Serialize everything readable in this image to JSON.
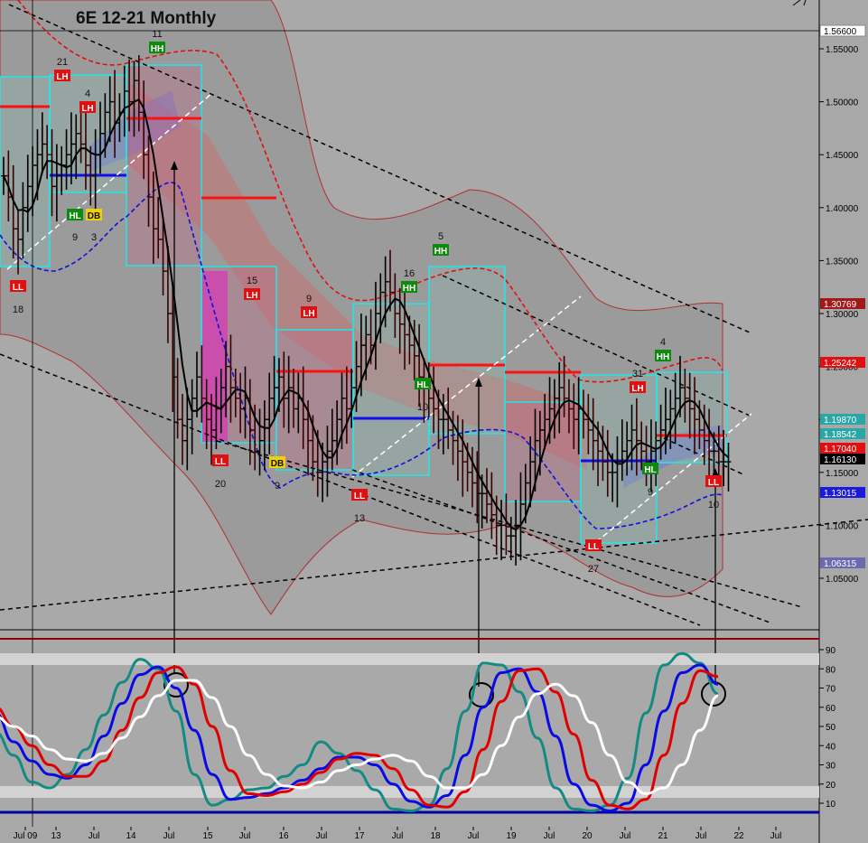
{
  "title": "6E 12-21 Monthly",
  "colors": {
    "background": "#a8a8a8",
    "price_bar": "#000000",
    "ma": "#000000",
    "upper_band": "#e01010",
    "lower_band": "#1010e0",
    "box": "#20e8e8",
    "label_red": "#e01010",
    "label_green": "#0e8a0e",
    "label_yellow": "#f0d000",
    "stoch_fast": "#138a82",
    "stoch_blue": "#0a0ae6",
    "stoch_red": "#e00000",
    "stoch_white": "#ffffff"
  },
  "chart_data": [
    {
      "type": "ohlc",
      "title": "6E 12-21 Monthly",
      "x_ticks": [
        "Jul 09",
        "13",
        "Jul",
        "14",
        "Jul",
        "15",
        "Jul",
        "16",
        "Jul",
        "17",
        "Jul",
        "18",
        "Jul",
        "19",
        "Jul",
        "20",
        "Jul",
        "21",
        "Jul",
        "22",
        "Jul"
      ],
      "y_ticks": [
        "1.55000",
        "1.50000",
        "1.45000",
        "1.40000",
        "1.35000",
        "1.30000",
        "1.25000",
        "1.20000",
        "1.15000",
        "1.10000",
        "1.05000"
      ],
      "ylim": [
        1.0,
        1.57
      ],
      "price_tags": [
        {
          "value": "1.56600",
          "style": "white"
        },
        {
          "value": "1.30769",
          "style": "darkred"
        },
        {
          "value": "1.25242",
          "style": "red"
        },
        {
          "value": "1.19870",
          "style": "teal"
        },
        {
          "value": "1.18542",
          "style": "teal"
        },
        {
          "value": "1.17040",
          "style": "red"
        },
        {
          "value": "1.16130",
          "style": "black"
        },
        {
          "value": "1.13015",
          "style": "blue"
        },
        {
          "value": "1.06315",
          "style": "slate"
        }
      ],
      "swing_labels": [
        {
          "text": "LH",
          "count": "21"
        },
        {
          "text": "LH",
          "count": "4"
        },
        {
          "text": "HH",
          "count": "11"
        },
        {
          "text": "HL",
          "count": "9"
        },
        {
          "text": "DB",
          "count": "3"
        },
        {
          "text": "LL",
          "count": "18"
        },
        {
          "text": "LH",
          "count": "15"
        },
        {
          "text": "LL",
          "count": "20"
        },
        {
          "text": "LH",
          "count": "9"
        },
        {
          "text": "DB",
          "count": "9"
        },
        {
          "text": "LL",
          "count": "13"
        },
        {
          "text": "HH",
          "count": "16"
        },
        {
          "text": "HL",
          "count": "10"
        },
        {
          "text": "HH",
          "count": "5"
        },
        {
          "text": "LL",
          "count": "27"
        },
        {
          "text": "LH",
          "count": "31"
        },
        {
          "text": "HH",
          "count": "4"
        },
        {
          "text": "HL",
          "count": "9"
        },
        {
          "text": "LL",
          "count": "10"
        }
      ],
      "series": [
        {
          "name": "",
          "x": [
            0,
            1,
            2,
            3,
            4,
            5,
            6,
            7,
            8,
            9,
            10,
            11,
            12,
            13,
            14,
            15,
            16,
            17,
            18,
            19,
            20,
            21,
            22,
            23,
            24,
            25,
            26,
            27,
            28,
            29,
            30,
            31,
            32,
            33,
            34,
            35,
            36,
            37,
            38,
            39,
            40,
            41,
            42,
            43,
            44,
            45,
            46,
            47,
            48,
            49,
            50,
            51,
            52,
            53,
            54,
            55,
            56,
            57,
            58,
            59,
            60,
            61,
            62,
            63,
            64,
            65,
            66,
            67,
            68,
            69,
            70,
            71,
            72,
            73,
            74,
            75,
            76,
            77,
            78,
            79,
            80,
            81,
            82,
            83,
            84,
            85,
            86,
            87,
            88,
            89,
            90,
            91,
            92,
            93,
            94,
            95,
            96,
            97,
            98,
            99,
            100,
            101,
            102,
            103,
            104,
            105,
            106,
            107,
            108,
            109,
            110,
            111,
            112,
            113,
            114,
            115,
            116,
            117,
            118,
            119,
            120,
            121,
            122,
            123,
            124,
            125,
            126,
            127,
            128,
            129,
            130,
            131,
            132,
            133,
            134,
            135,
            136,
            137,
            138,
            139,
            140,
            141,
            142,
            143,
            144,
            145,
            146,
            147,
            148,
            149,
            150
          ],
          "y": [
            1.43,
            1.41,
            1.38,
            1.37,
            1.4,
            1.42,
            1.44,
            1.45,
            1.46,
            1.45,
            1.42,
            1.43,
            1.44,
            1.45,
            1.46,
            1.47,
            1.46,
            1.44,
            1.43,
            1.45,
            1.47,
            1.49,
            1.5,
            1.48,
            1.49,
            1.51,
            1.5,
            1.52,
            1.49,
            1.45,
            1.41,
            1.38,
            1.37,
            1.34,
            1.3,
            1.24,
            1.2,
            1.18,
            1.2,
            1.22,
            1.24,
            1.22,
            1.2,
            1.19,
            1.21,
            1.23,
            1.25,
            1.23,
            1.22,
            1.21,
            1.22,
            1.19,
            1.17,
            1.18,
            1.2,
            1.22,
            1.23,
            1.24,
            1.22,
            1.23,
            1.21,
            1.22,
            1.2,
            1.18,
            1.16,
            1.15,
            1.16,
            1.17,
            1.18,
            1.2,
            1.22,
            1.21,
            1.23,
            1.25,
            1.27,
            1.28,
            1.27,
            1.3,
            1.32,
            1.33,
            1.32,
            1.3,
            1.29,
            1.28,
            1.27,
            1.26,
            1.24,
            1.23,
            1.22,
            1.21,
            1.2,
            1.2,
            1.19,
            1.18,
            1.17,
            1.16,
            1.15,
            1.14,
            1.13,
            1.13,
            1.12,
            1.11,
            1.1,
            1.1,
            1.09,
            1.09,
            1.1,
            1.12,
            1.14,
            1.16,
            1.18,
            1.19,
            1.2,
            1.21,
            1.22,
            1.23,
            1.22,
            1.21,
            1.2,
            1.21,
            1.2,
            1.19,
            1.18,
            1.17,
            1.16,
            1.15,
            1.15,
            1.16,
            1.17,
            1.18,
            1.19,
            1.18,
            1.17,
            1.16,
            1.17,
            1.18,
            1.19,
            1.2,
            1.21,
            1.22,
            1.23,
            1.22,
            1.21,
            1.2,
            1.19,
            1.18,
            1.17,
            1.17,
            1.16,
            1.16,
            1.16
          ]
        }
      ]
    },
    {
      "type": "line",
      "title": "",
      "y_ticks": [
        "90",
        "80",
        "70",
        "60",
        "50",
        "40",
        "30",
        "20",
        "10"
      ],
      "ylim": [
        0,
        100
      ],
      "series": [
        {
          "name": "",
          "values": [
            47,
            35,
            21,
            18,
            25,
            38,
            56,
            73,
            85,
            80,
            58,
            25,
            9,
            12,
            17,
            18,
            24,
            30,
            42,
            36,
            27,
            17,
            7,
            6,
            9,
            28,
            58,
            83,
            82,
            68,
            44,
            18,
            7,
            6,
            9,
            23,
            57,
            82,
            88,
            83,
            67
          ]
        },
        {
          "name": "",
          "values": [
            57,
            42,
            32,
            25,
            23,
            30,
            45,
            62,
            77,
            81,
            70,
            48,
            25,
            12,
            13,
            15,
            18,
            22,
            28,
            34,
            34,
            30,
            20,
            11,
            8,
            14,
            35,
            60,
            78,
            80,
            68,
            45,
            20,
            9,
            6,
            10,
            30,
            58,
            78,
            82,
            72
          ]
        },
        {
          "name": "",
          "values": [
            60,
            50,
            40,
            30,
            24,
            24,
            32,
            48,
            65,
            78,
            81,
            72,
            50,
            27,
            15,
            14,
            16,
            20,
            26,
            33,
            36,
            35,
            28,
            17,
            9,
            8,
            16,
            38,
            63,
            79,
            80,
            68,
            46,
            22,
            9,
            7,
            12,
            35,
            62,
            79,
            76
          ]
        },
        {
          "name": "",
          "values": [
            55,
            50,
            45,
            38,
            33,
            32,
            36,
            44,
            55,
            66,
            74,
            74,
            65,
            50,
            35,
            25,
            19,
            18,
            21,
            27,
            30,
            33,
            35,
            32,
            24,
            18,
            18,
            25,
            40,
            55,
            67,
            72,
            66,
            52,
            35,
            21,
            15,
            18,
            30,
            48,
            66
          ]
        }
      ]
    }
  ]
}
